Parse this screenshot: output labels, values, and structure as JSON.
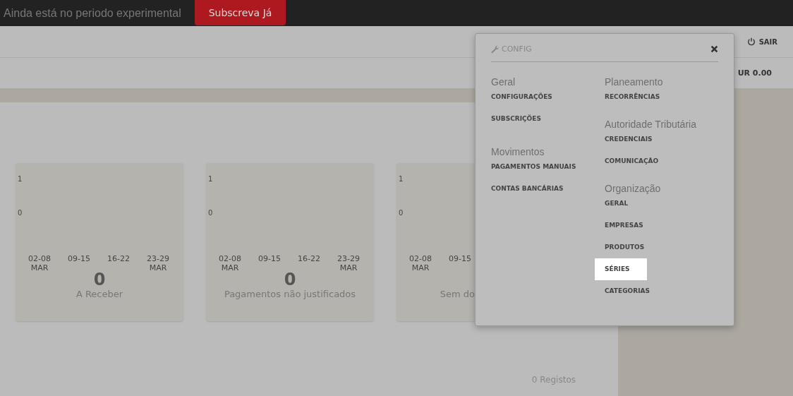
{
  "trial_bar": {
    "message": "Ainda está no periodo experimental",
    "button": "Subscreva Já"
  },
  "header": {
    "logout": "SAIR",
    "balance": "UR 0.00"
  },
  "cards": [
    {
      "y_ticks": [
        "1",
        "0"
      ],
      "x_ticks": [
        {
          "range": "02-08",
          "month": "MAR"
        },
        {
          "range": "09-15"
        },
        {
          "range": "16-22"
        },
        {
          "range": "23-29",
          "month": "MAR"
        }
      ],
      "value": "0",
      "caption": "A Receber"
    },
    {
      "y_ticks": [
        "1",
        "0"
      ],
      "x_ticks": [
        {
          "range": "02-08",
          "month": "MAR"
        },
        {
          "range": "09-15"
        },
        {
          "range": "16-22"
        },
        {
          "range": "23-29",
          "month": "MAR"
        }
      ],
      "value": "0",
      "caption": "Pagamentos não justificados"
    },
    {
      "y_ticks": [
        "1",
        "0"
      ],
      "x_ticks": [
        {
          "range": "02-08",
          "month": "MAR"
        },
        {
          "range": "09-15"
        }
      ],
      "caption": "Sem do"
    }
  ],
  "records": "0 Registos",
  "config_menu": {
    "title": "CONFIG",
    "columns": [
      [
        {
          "heading": "Geral",
          "items": [
            {
              "label": "CONFIGURAÇÕES",
              "selected": false
            },
            {
              "label": "SUBSCRIÇÕES",
              "selected": false
            }
          ]
        },
        {
          "heading": "Movimentos",
          "items": [
            {
              "label": "PAGAMENTOS MANUAIS",
              "selected": false
            },
            {
              "label": "CONTAS BANCÁRIAS",
              "selected": false
            }
          ]
        }
      ],
      [
        {
          "heading": "Planeamento",
          "items": [
            {
              "label": "RECORRÊNCIAS",
              "selected": false
            }
          ]
        },
        {
          "heading": "Autoridade Tributária",
          "items": [
            {
              "label": "CREDENCIAIS",
              "selected": false
            },
            {
              "label": "COMUNICAÇÃO",
              "selected": false
            }
          ]
        },
        {
          "heading": "Organização",
          "items": [
            {
              "label": "GERAL",
              "selected": false
            },
            {
              "label": "EMPRESAS",
              "selected": false
            },
            {
              "label": "PRODUTOS",
              "selected": false
            },
            {
              "label": "SÉRIES",
              "selected": true
            },
            {
              "label": "CATEGORIAS",
              "selected": false
            }
          ]
        }
      ]
    ]
  }
}
